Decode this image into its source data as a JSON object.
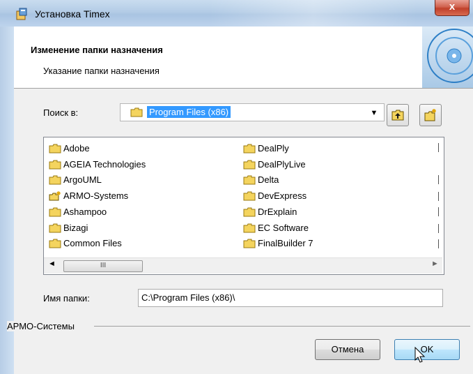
{
  "window": {
    "title": "Установка Timex",
    "close_symbol": "x"
  },
  "header": {
    "title": "Изменение папки назначения",
    "subtitle": "Указание папки назначения"
  },
  "lookin": {
    "label": "Поиск в:",
    "value": "Program Files (x86)",
    "dropdown_glyph": "▼"
  },
  "folders_left": [
    {
      "name": "Adobe",
      "icon": "folder-icon"
    },
    {
      "name": "AGEIA Technologies",
      "icon": "folder-icon"
    },
    {
      "name": "ArgoUML",
      "icon": "folder-icon"
    },
    {
      "name": "ARMO-Systems",
      "icon": "new-folder-icon"
    },
    {
      "name": "Ashampoo",
      "icon": "folder-icon"
    },
    {
      "name": "Bizagi",
      "icon": "folder-icon"
    },
    {
      "name": "Common Files",
      "icon": "folder-icon"
    }
  ],
  "folders_right": [
    {
      "name": "DealPly",
      "icon": "folder-icon"
    },
    {
      "name": "DealPlyLive",
      "icon": "folder-icon"
    },
    {
      "name": "Delta",
      "icon": "folder-icon"
    },
    {
      "name": "DevExpress",
      "icon": "folder-icon"
    },
    {
      "name": "DrExplain",
      "icon": "folder-icon"
    },
    {
      "name": "EC Software",
      "icon": "folder-icon"
    },
    {
      "name": "FinalBuilder 7",
      "icon": "folder-icon"
    }
  ],
  "scrollbar": {
    "left_arrow": "◄",
    "right_arrow": "►",
    "thumb_grip": "III"
  },
  "folder_name": {
    "label": "Имя папки:",
    "value": "C:\\Program Files (x86)\\"
  },
  "group": {
    "label": "АРМО-Системы"
  },
  "buttons": {
    "cancel": "Отмена",
    "ok": "OK"
  },
  "colors": {
    "selection": "#3399ff",
    "titlebar": "#b3cce6",
    "close": "#c0402b"
  }
}
